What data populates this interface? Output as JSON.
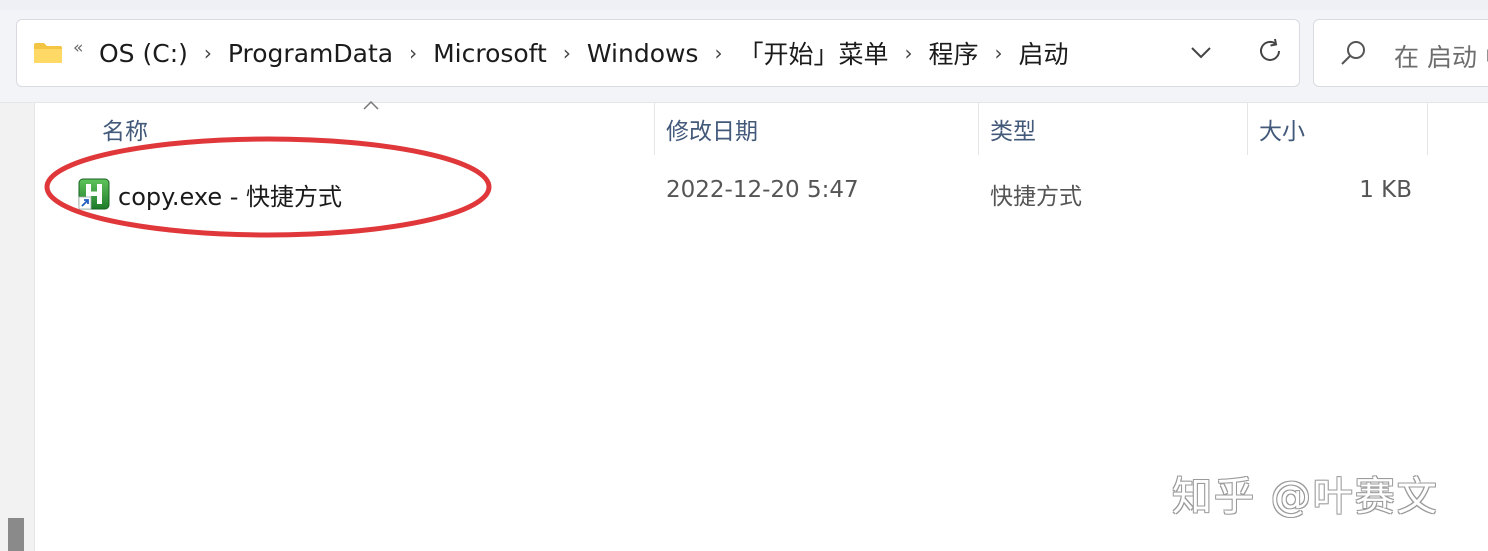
{
  "address_bar": {
    "overflow_glyph": "«",
    "breadcrumbs": [
      "OS (C:)",
      "ProgramData",
      "Microsoft",
      "Windows",
      "「开始」菜单",
      "程序",
      "启动"
    ],
    "separator_glyph": "›"
  },
  "search": {
    "placeholder": "在 启动 中"
  },
  "columns": [
    {
      "label": "名称"
    },
    {
      "label": "修改日期"
    },
    {
      "label": "类型"
    },
    {
      "label": "大小"
    }
  ],
  "files": [
    {
      "name": "copy.exe - 快捷方式",
      "modified": "2022-12-20 5:47",
      "type": "快捷方式",
      "size": "1 KB",
      "icon": "shortcut-app-icon"
    }
  ],
  "annotation_color": "#e0383a",
  "watermark": "知乎 @叶赛文",
  "colors": {
    "header_text": "#43597a",
    "folder": "#f4c542",
    "app_icon": "#2f9e3f"
  }
}
